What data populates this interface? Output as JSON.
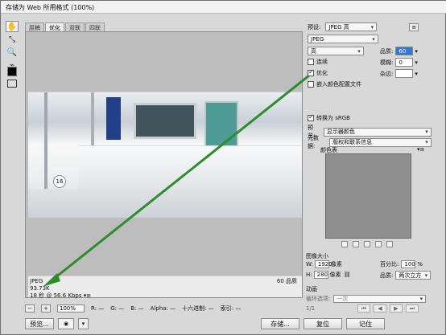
{
  "window": {
    "title": "存储为 Web 所用格式 (100%)"
  },
  "tabs": [
    {
      "label": "原稿"
    },
    {
      "label": "优化"
    },
    {
      "label": "双联"
    },
    {
      "label": "四联"
    }
  ],
  "canvas": {
    "info_left_1": "JPEG",
    "info_left_2": "93.73K",
    "info_left_3": "18 秒 @ 56.6 Kbps ▾≡",
    "info_right": "60 品质"
  },
  "statusbar": {
    "zoom": "100%",
    "r": "R: —",
    "g": "G: —",
    "b": "B: —",
    "alpha": "Alpha: —",
    "hex": "十六进制: —",
    "index": "索引: —"
  },
  "footer": {
    "preview_label": "预览...",
    "save_label": "存储...",
    "reset_label": "复位",
    "remember_label": "记住"
  },
  "settings": {
    "preset_label": "预设:",
    "preset_value": "JPEG 高",
    "format_value": "JPEG",
    "quality_select": "高",
    "quality_label": "品质:",
    "quality_value": "60",
    "progressive_label": "连续",
    "blur_label": "模糊:",
    "blur_value": "0",
    "optimized_label": "优化",
    "matte_label": "杂边:",
    "embed_profile_label": "嵌入颜色配置文件",
    "convert_srgb_label": "转换为 sRGB",
    "preview_mode_label": "预览:",
    "preview_mode_value": "显示器颜色",
    "metadata_label": "元数据:",
    "metadata_value": "版权和联系信息",
    "color_table_label": "颜色表",
    "image_size_label": "图像大小",
    "width_label": "W:",
    "width_value": "1920",
    "height_label": "H:",
    "height_value": "280",
    "unit_label": "像素",
    "percent_label": "百分比:",
    "percent_value": "100",
    "percent_unit": "%",
    "quality_method_label": "品质:",
    "quality_method_value": "两次立方",
    "animation_label": "动画",
    "loop_label": "循环选项:",
    "loop_value": "一次",
    "frame_text": "1/1"
  }
}
